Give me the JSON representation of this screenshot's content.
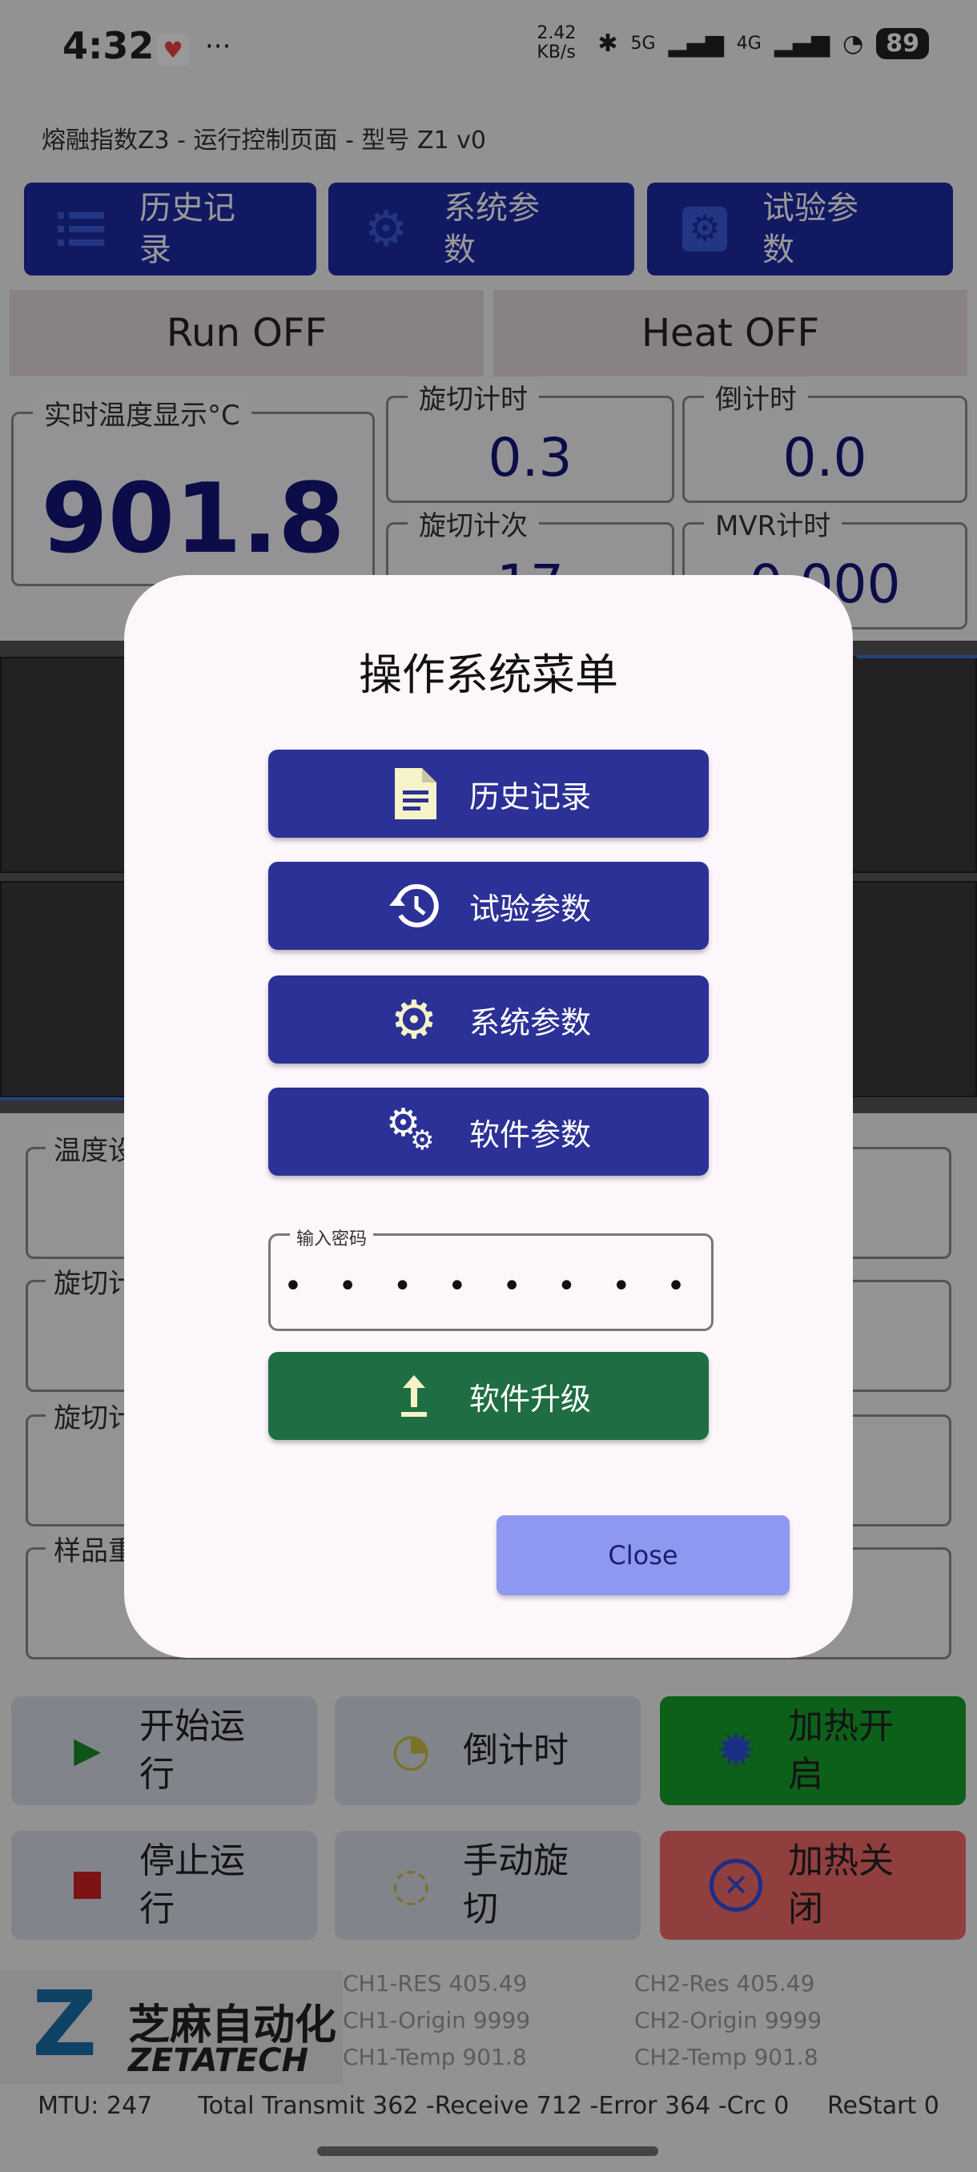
{
  "status": {
    "time": "4:32",
    "speed": "2.42 KB/s",
    "net1": "5G",
    "net2": "4G",
    "battery": "89"
  },
  "app": {
    "title": "熔融指数Z3 - 运行控制页面 - 型号 Z1 v0",
    "top_buttons": [
      {
        "label": "历史记录",
        "icon": "list-icon"
      },
      {
        "label": "系统参数",
        "icon": "gear-icon"
      },
      {
        "label": "试验参数",
        "icon": "settings-box-icon"
      }
    ],
    "run_state": "Run OFF",
    "heat_state": "Heat OFF",
    "temp": {
      "label": "实时温度显示°C",
      "value": "901.8"
    },
    "cut_timer": {
      "label": "旋切计时",
      "value": "0.3"
    },
    "countdown": {
      "label": "倒计时",
      "value": "0.0"
    },
    "cut_count": {
      "label": "旋切计次",
      "value": "17"
    },
    "mvr_timer": {
      "label": "MVR计时",
      "value": "0.000"
    },
    "params": [
      "温度设",
      "旋切计",
      "旋切计",
      "样品重"
    ],
    "controls": [
      {
        "label": "开始运行",
        "icon": "play-icon"
      },
      {
        "label": "倒计时",
        "icon": "timer-icon"
      },
      {
        "label": "加热开启",
        "icon": "sun-icon"
      },
      {
        "label": "停止运行",
        "icon": "stop-icon"
      },
      {
        "label": "手动旋切",
        "icon": "sync-icon"
      },
      {
        "label": "加热关闭",
        "icon": "close-circle-icon"
      }
    ],
    "logo": {
      "cn": "芝麻自动化",
      "en": "ZETATECH"
    },
    "ch1": [
      "CH1-RES  405.49",
      "CH1-Origin  9999",
      "CH1-Temp  901.8"
    ],
    "ch2": [
      "CH2-Res  405.49",
      "CH2-Origin  9999",
      "CH2-Temp  901.8"
    ],
    "footer": "MTU: 247      Total Transmit 362 -Receive 712 -Error 364 -Crc 0     ReStart 0"
  },
  "dialog": {
    "title": "操作系统菜单",
    "menu": [
      {
        "label": "历史记录",
        "icon": "document-icon"
      },
      {
        "label": "试验参数",
        "icon": "history-icon"
      },
      {
        "label": "系统参数",
        "icon": "gear-icon"
      },
      {
        "label": "软件参数",
        "icon": "gears-icon"
      }
    ],
    "password": {
      "label": "输入密码",
      "value": "• • • • • • • •"
    },
    "upgrade": {
      "label": "软件升级",
      "icon": "upload-icon"
    },
    "close": "Close"
  },
  "colors": {
    "primary": "#2b3196",
    "upgrade": "#1f6e43",
    "close": "#8e98f0"
  }
}
